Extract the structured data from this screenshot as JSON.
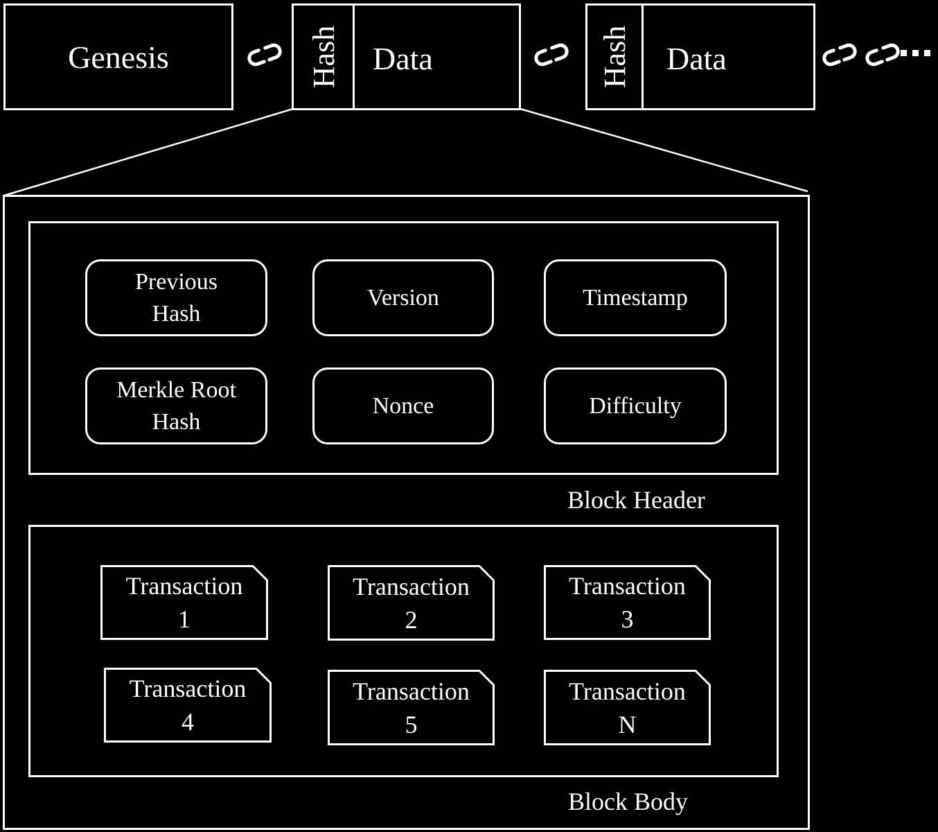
{
  "chain": {
    "genesis_label": "Genesis",
    "block2": {
      "hash_label": "Hash",
      "data_label": "Data"
    },
    "block3": {
      "hash_label": "Hash",
      "data_label": "Data"
    },
    "continuation": "..."
  },
  "block": {
    "header": {
      "caption": "Block Header",
      "fields": [
        {
          "line1": "Previous",
          "line2": "Hash"
        },
        {
          "line1": "Version",
          "line2": ""
        },
        {
          "line1": "Timestamp",
          "line2": ""
        },
        {
          "line1": "Merkle Root",
          "line2": "Hash"
        },
        {
          "line1": "Nonce",
          "line2": ""
        },
        {
          "line1": "Difficulty",
          "line2": ""
        }
      ]
    },
    "body": {
      "caption": "Block Body",
      "transactions": [
        {
          "line1": "Transaction",
          "line2": "1"
        },
        {
          "line1": "Transaction",
          "line2": "2"
        },
        {
          "line1": "Transaction",
          "line2": "3"
        },
        {
          "line1": "Transaction",
          "line2": "4"
        },
        {
          "line1": "Transaction",
          "line2": "5"
        },
        {
          "line1": "Transaction",
          "line2": "N"
        }
      ]
    }
  }
}
